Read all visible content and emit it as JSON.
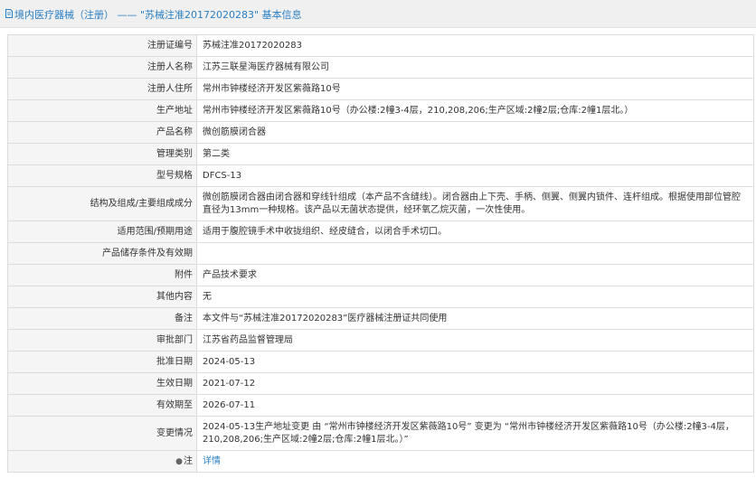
{
  "header": {
    "title": "境内医疗器械（注册） —— \"苏械注准20172020283\" 基本信息"
  },
  "rows": [
    {
      "label": "注册证编号",
      "value": "苏械注准20172020283"
    },
    {
      "label": "注册人名称",
      "value": "江苏三联星海医疗器械有限公司"
    },
    {
      "label": "注册人住所",
      "value": "常州市钟楼经济开发区紫薇路10号"
    },
    {
      "label": "生产地址",
      "value": "常州市钟楼经济开发区紫薇路10号（办公楼:2幢3-4层，210,208,206;生产区域:2幢2层;仓库:2幢1层北。）"
    },
    {
      "label": "产品名称",
      "value": "微创筋膜闭合器"
    },
    {
      "label": "管理类别",
      "value": "第二类"
    },
    {
      "label": "型号规格",
      "value": "DFCS-13"
    },
    {
      "label": "结构及组成/主要组成成分",
      "value": "微创筋膜闭合器由闭合器和穿线针组成（本产品不含缝线）。闭合器由上下壳、手柄、侧翼、侧翼内锁件、连杆组成。根据使用部位管腔直径为13mm一种规格。该产品以无菌状态提供，经环氧乙烷灭菌，一次性使用。"
    },
    {
      "label": "适用范围/预期用途",
      "value": "适用于腹腔镜手术中收拢组织、经皮缝合，以闭合手术切口。"
    },
    {
      "label": "产品储存条件及有效期",
      "value": ""
    },
    {
      "label": "附件",
      "value": "产品技术要求"
    },
    {
      "label": "其他内容",
      "value": "无"
    },
    {
      "label": "备注",
      "value": "本文件与“苏械注准20172020283”医疗器械注册证共同使用"
    },
    {
      "label": "审批部门",
      "value": "江苏省药品监督管理局"
    },
    {
      "label": "批准日期",
      "value": "2024-05-13"
    },
    {
      "label": "生效日期",
      "value": "2021-07-12"
    },
    {
      "label": "有效期至",
      "value": "2026-07-11"
    },
    {
      "label": "变更情况",
      "value": "2024-05-13生产地址变更 由 “常州市钟楼经济开发区紫薇路10号” 变更为 “常州市钟楼经济开发区紫薇路10号（办公楼:2幢3-4层，210,208,206;生产区域:2幢2层;仓库:2幢1层北。）”"
    }
  ],
  "note": {
    "label": "注",
    "link": "详情",
    "icon": "bulb-icon"
  },
  "colors": {
    "link": "#2b7fc3",
    "label_bg": "#f5f5f5",
    "border": "#dcdcdc",
    "title_bg": "#f0f0f0"
  }
}
